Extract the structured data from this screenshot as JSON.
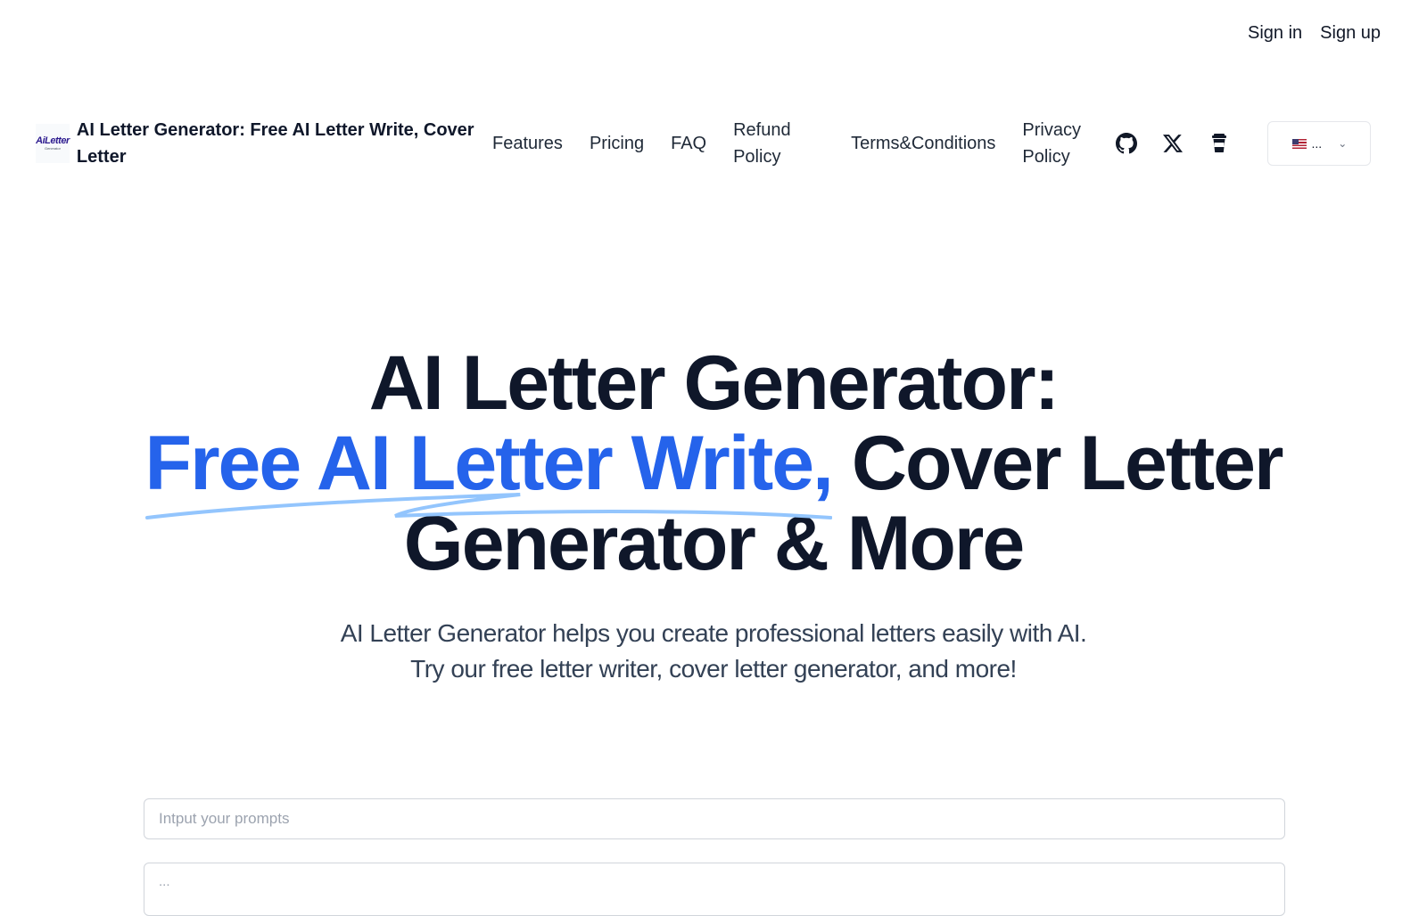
{
  "auth": {
    "sign_in": "Sign in",
    "sign_up": "Sign up"
  },
  "brand": {
    "logo_text": "AiLetter",
    "logo_subtext": "Generator",
    "title": "AI Letter Generator: Free AI Letter Write, Cover Letter"
  },
  "nav": {
    "features": "Features",
    "pricing": "Pricing",
    "faq": "FAQ",
    "refund_policy": "Refund Policy",
    "terms": "Terms&Conditions",
    "privacy_policy": "Privacy Policy",
    "icons": [
      "github-icon",
      "x-twitter-icon",
      "coffee-cup-icon"
    ],
    "language": {
      "flag": "us-flag-icon",
      "label": "..."
    }
  },
  "hero": {
    "title_line1": "AI Letter Generator:",
    "title_accent": "Free AI Letter Write,",
    "title_line2_rest": " Cover Letter",
    "title_line3": "Generator & More",
    "subtitle_line1": "AI Letter Generator helps you create professional letters easily with AI.",
    "subtitle_line2": "Try our free letter writer, cover letter generator, and more!"
  },
  "form": {
    "prompt_placeholder": "Intput your prompts",
    "second_field_text": "..."
  },
  "colors": {
    "accent": "#2563eb",
    "swoosh": "#93c5fd",
    "heading": "#0f172a",
    "subtext": "#334155"
  }
}
